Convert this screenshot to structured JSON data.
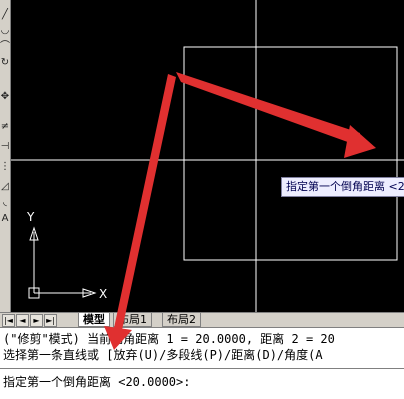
{
  "toolbar": {
    "icons": [
      "line-icon",
      "polyline-icon",
      "arc-icon",
      "rotate-icon",
      "move-icon",
      "trim-icon",
      "extend-icon",
      "break-icon",
      "chamfer-icon",
      "fillet-icon",
      "text-icon"
    ]
  },
  "canvas": {
    "ucs": {
      "y_label": "Y",
      "x_label": "X"
    },
    "tooltip": "指定第一个倒角距离 <20"
  },
  "tabs": {
    "nav": [
      "|◄",
      "◄",
      "►",
      "►|"
    ],
    "items": [
      "模型",
      "布局1",
      "布局2"
    ],
    "active": "模型"
  },
  "command": {
    "history": [
      "(\"修剪\"模式) 当前倒角距离 1 = 20.0000, 距离 2 = 20",
      "选择第一条直线或 [放弃(U)/多段线(P)/距离(D)/角度(A"
    ],
    "prompt": "指定第一个倒角距离 <20.0000>:"
  },
  "colors": {
    "canvas_bg": "#000000",
    "geometry": "#ffffff",
    "annotation_arrow": "#e03030",
    "ui_gray": "#d4d0c8"
  }
}
